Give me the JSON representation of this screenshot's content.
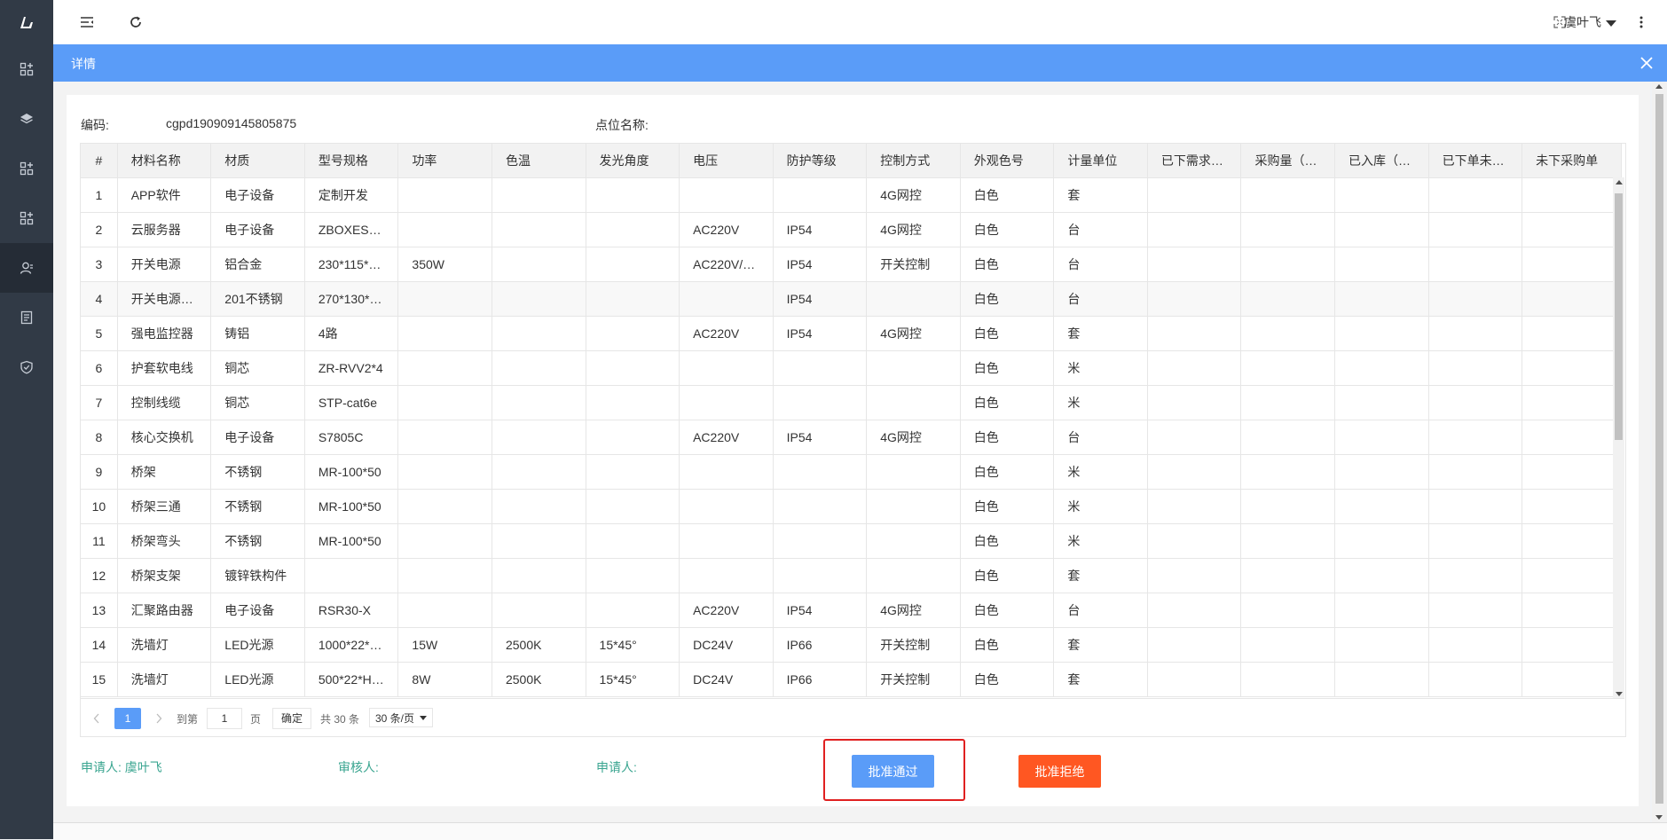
{
  "topbar": {
    "user_name": "虞叶飞"
  },
  "modal": {
    "title": "详情"
  },
  "info": {
    "code_label": "编码:",
    "code_value": "cgpd190909145805875",
    "point_label": "点位名称:"
  },
  "table": {
    "headers": [
      "#",
      "材料名称",
      "材质",
      "型号规格",
      "功率",
      "色温",
      "发光角度",
      "电压",
      "防护等级",
      "控制方式",
      "外观色号",
      "计量单位",
      "已下需求…",
      "采购量（…",
      "已入库（…",
      "已下单未…",
      "未下采购单"
    ],
    "rows": [
      [
        "1",
        "APP软件",
        "电子设备",
        "定制开发",
        "",
        "",
        "",
        "",
        "",
        "4G网控",
        "白色",
        "套",
        "",
        "",
        "",
        "",
        ""
      ],
      [
        "2",
        "云服务器",
        "电子设备",
        "ZBOXES…",
        "",
        "",
        "",
        "AC220V",
        "IP54",
        "4G网控",
        "白色",
        "台",
        "",
        "",
        "",
        "",
        ""
      ],
      [
        "3",
        "开关电源",
        "铝合金",
        "230*115*…",
        "350W",
        "",
        "",
        "AC220V/…",
        "IP54",
        "开关控制",
        "白色",
        "台",
        "",
        "",
        "",
        "",
        ""
      ],
      [
        "4",
        "开关电源…",
        "201不锈钢",
        "270*130*…",
        "",
        "",
        "",
        "",
        "IP54",
        "",
        "白色",
        "台",
        "",
        "",
        "",
        "",
        ""
      ],
      [
        "5",
        "强电监控器",
        "铸铝",
        "4路",
        "",
        "",
        "",
        "AC220V",
        "IP54",
        "4G网控",
        "白色",
        "套",
        "",
        "",
        "",
        "",
        ""
      ],
      [
        "6",
        "护套软电线",
        "铜芯",
        "ZR-RVV2*4",
        "",
        "",
        "",
        "",
        "",
        "",
        "白色",
        "米",
        "",
        "",
        "",
        "",
        ""
      ],
      [
        "7",
        "控制线缆",
        "铜芯",
        "STP-cat6e",
        "",
        "",
        "",
        "",
        "",
        "",
        "白色",
        "米",
        "",
        "",
        "",
        "",
        ""
      ],
      [
        "8",
        "核心交换机",
        "电子设备",
        "S7805C",
        "",
        "",
        "",
        "AC220V",
        "IP54",
        "4G网控",
        "白色",
        "台",
        "",
        "",
        "",
        "",
        ""
      ],
      [
        "9",
        "桥架",
        "不锈钢",
        "MR-100*50",
        "",
        "",
        "",
        "",
        "",
        "",
        "白色",
        "米",
        "",
        "",
        "",
        "",
        ""
      ],
      [
        "10",
        "桥架三通",
        "不锈钢",
        "MR-100*50",
        "",
        "",
        "",
        "",
        "",
        "",
        "白色",
        "米",
        "",
        "",
        "",
        "",
        ""
      ],
      [
        "11",
        "桥架弯头",
        "不锈钢",
        "MR-100*50",
        "",
        "",
        "",
        "",
        "",
        "",
        "白色",
        "米",
        "",
        "",
        "",
        "",
        ""
      ],
      [
        "12",
        "桥架支架",
        "镀锌铁构件",
        "",
        "",
        "",
        "",
        "",
        "",
        "",
        "白色",
        "套",
        "",
        "",
        "",
        "",
        ""
      ],
      [
        "13",
        "汇聚路由器",
        "电子设备",
        "RSR30-X",
        "",
        "",
        "",
        "AC220V",
        "IP54",
        "4G网控",
        "白色",
        "台",
        "",
        "",
        "",
        "",
        ""
      ],
      [
        "14",
        "洗墙灯",
        "LED光源",
        "1000*22*…",
        "15W",
        "2500K",
        "15*45°",
        "DC24V",
        "IP66",
        "开关控制",
        "白色",
        "套",
        "",
        "",
        "",
        "",
        ""
      ],
      [
        "15",
        "洗墙灯",
        "LED光源",
        "500*22*H…",
        "8W",
        "2500K",
        "15*45°",
        "DC24V",
        "IP66",
        "开关控制",
        "白色",
        "套",
        "",
        "",
        "",
        "",
        ""
      ]
    ]
  },
  "pager": {
    "current_page": "1",
    "goto_label": "到第",
    "page_input": "1",
    "page_unit": "页",
    "confirm": "确定",
    "total": "共 30 条",
    "page_size": "30 条/页"
  },
  "footer": {
    "applicant1": "申请人: 虞叶飞",
    "reviewer": "审核人:",
    "applicant2": "申请人:",
    "approve": "批准通过",
    "reject": "批准拒绝"
  },
  "colors": {
    "sidebar_bg": "#313a46",
    "accent_blue": "#5a9cf8",
    "reject_orange": "#ff5722",
    "footer_green": "#3aa590",
    "highlight_red": "#e02020"
  },
  "icons": {
    "logo": "logo-icon",
    "menu_toggle": "menu-toggle-icon",
    "refresh": "refresh-icon",
    "fullscreen": "fullscreen-icon",
    "more": "more-vertical-icon",
    "close": "close-icon"
  }
}
